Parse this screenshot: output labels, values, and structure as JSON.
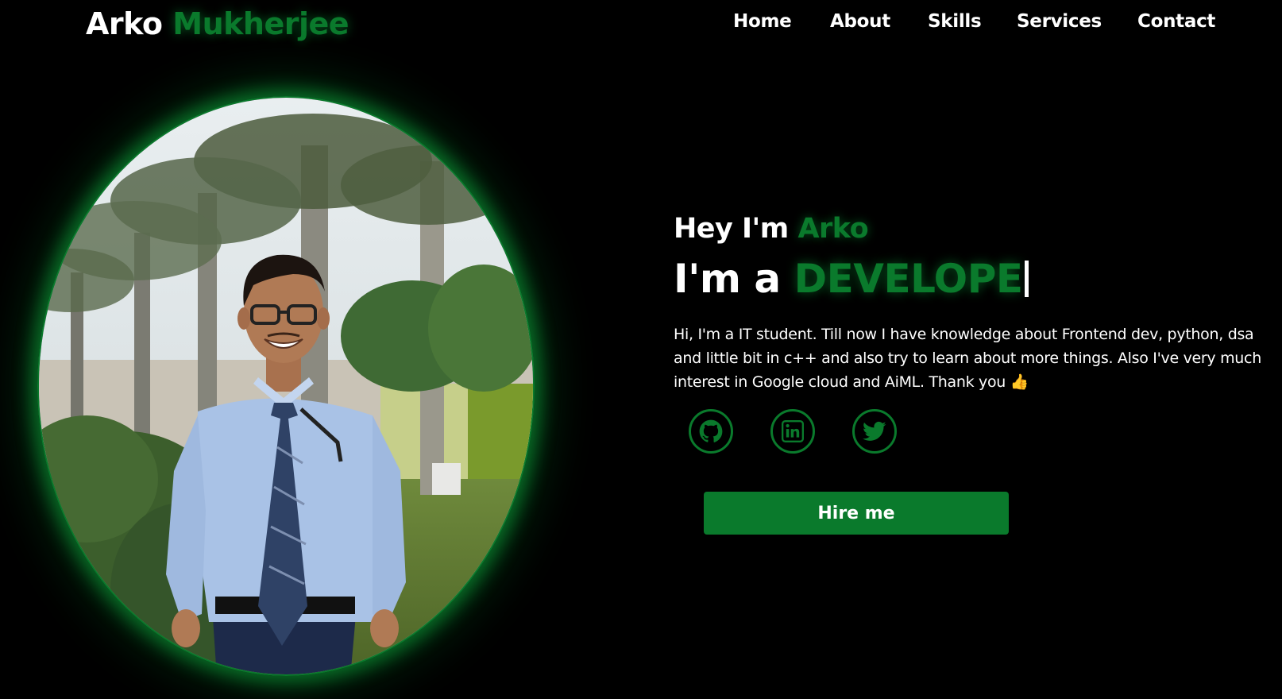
{
  "header": {
    "logo_first": "Arko",
    "logo_last": "Mukherjee"
  },
  "nav": {
    "items": [
      {
        "label": "Home"
      },
      {
        "label": "About"
      },
      {
        "label": "Skills"
      },
      {
        "label": "Services"
      },
      {
        "label": "Contact"
      }
    ]
  },
  "hero": {
    "greeting": "Hey I'm",
    "greeting_name": "Arko",
    "role_prefix": "I'm a",
    "role_typed": "DEVELOPE",
    "intro": "Hi, I'm a IT student. Till now I have knowledge about Frontend dev, python, dsa and little bit in c++ and also try to learn about more things. Also I've very much interest in Google cloud and AiML. Thank you 👍",
    "hire_label": "Hire me"
  },
  "socials": [
    {
      "icon": "github-icon"
    },
    {
      "icon": "linkedin-icon"
    },
    {
      "icon": "twitter-icon"
    }
  ],
  "colors": {
    "accent": "#0a7a2c",
    "background": "#000000",
    "text": "#ffffff"
  }
}
